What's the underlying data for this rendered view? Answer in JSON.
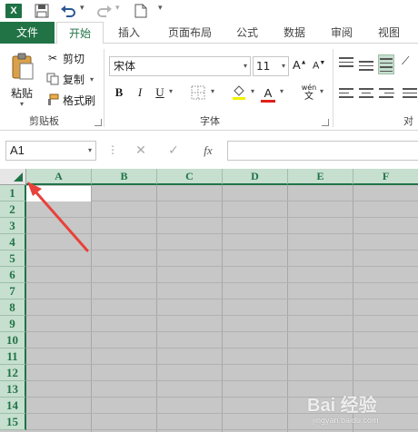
{
  "qat": {
    "logo_text": "X",
    "icons": [
      "excel-logo-icon",
      "save-icon",
      "undo-icon",
      "redo-icon",
      "new-file-icon",
      "customize-qat-icon"
    ]
  },
  "tabs": {
    "file": "文件",
    "home": "开始",
    "insert": "插入",
    "page_layout": "页面布局",
    "formulas": "公式",
    "data": "数据",
    "review": "审阅",
    "view": "视图"
  },
  "ribbon": {
    "clipboard": {
      "paste_label": "粘贴",
      "cut_label": "剪切",
      "copy_label": "复制",
      "format_painter_label": "格式刷",
      "group_label": "剪贴板"
    },
    "font": {
      "font_name": "宋体",
      "font_size": "11",
      "grow_label": "A",
      "shrink_label": "A",
      "bold_label": "B",
      "italic_label": "I",
      "underline_label": "U",
      "font_color_label": "A",
      "phonetic_label": "wén",
      "phonetic_sub": "文",
      "group_label": "字体"
    },
    "alignment": {
      "group_label_partial": "对"
    }
  },
  "formula_bar": {
    "name_box": "A1",
    "fx_label": "fx",
    "cancel_glyph": "✕",
    "enter_glyph": "✓",
    "dots": "⋮",
    "formula_value": ""
  },
  "sheet": {
    "columns": [
      "A",
      "B",
      "C",
      "D",
      "E",
      "F"
    ],
    "rows": [
      "1",
      "2",
      "3",
      "4",
      "5",
      "6",
      "7",
      "8",
      "9",
      "10",
      "11",
      "12",
      "13",
      "14",
      "15"
    ],
    "active_cell": "A1",
    "state": "all cells selected"
  },
  "colors": {
    "accent": "#217346",
    "header_selected": "#c6dfcf",
    "selection_fill": "#c7c7c7",
    "annotation_arrow": "#e8413a"
  },
  "watermark": {
    "text": "Bai 经验",
    "sub": "jingyan.baidu.com"
  }
}
